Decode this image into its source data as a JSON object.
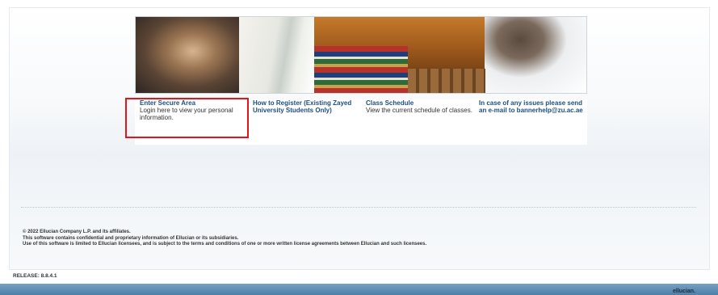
{
  "links": [
    {
      "title": "Enter Secure Area",
      "description": "Login here to view your personal information."
    },
    {
      "title": "How to Register (Existing Zayed University Students Only)",
      "description": ""
    },
    {
      "title": "Class Schedule",
      "description": "View the current schedule of classes."
    },
    {
      "title": "In case of any issues please send an e-mail to bannerhelp@zu.ac.ae",
      "description": ""
    }
  ],
  "footer": {
    "line1": "© 2022 Ellucian Company L.P. and its affiliates.",
    "line2": "This software contains confidential and proprietary information of Ellucian or its subsidiaries.",
    "line3": "Use of this software is limited to Ellucian licensees, and is subject to the terms and conditions of one or more written license agreements between Ellucian and such licensees."
  },
  "release": "RELEASE: 8.8.4.1",
  "brand": "ellucian.",
  "colors": {
    "highlight": "#e5141b",
    "link": "#1d4f82",
    "bar": "#5f8fb5"
  }
}
